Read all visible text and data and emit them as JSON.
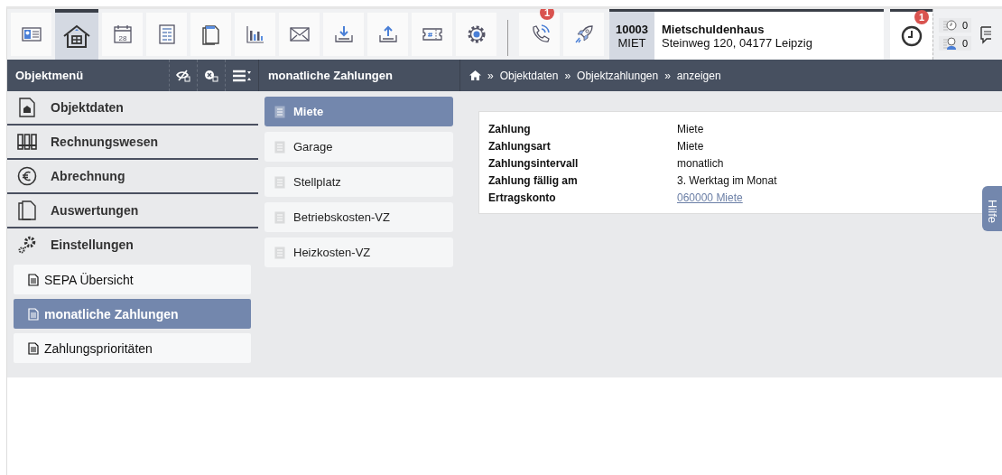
{
  "toolbar": {
    "buttons": [
      {
        "kind": "contact",
        "selected": false
      },
      {
        "kind": "home",
        "selected": true
      },
      {
        "kind": "calendar",
        "selected": false,
        "text": "28"
      },
      {
        "kind": "form",
        "selected": false
      },
      {
        "kind": "pages",
        "selected": false
      },
      {
        "kind": "chart",
        "selected": false
      },
      {
        "kind": "mail",
        "selected": false
      },
      {
        "kind": "download",
        "selected": false
      },
      {
        "kind": "upload",
        "selected": false
      },
      {
        "kind": "ticket",
        "selected": false
      },
      {
        "kind": "gear",
        "selected": false
      }
    ],
    "extra_buttons": [
      {
        "kind": "phone",
        "badge": "1"
      },
      {
        "kind": "rocket"
      }
    ],
    "object": {
      "number": "10003",
      "code": "MIET",
      "name": "Mietschuldenhaus",
      "address": "Steinweg 120, 04177 Leipzig"
    },
    "clock": {
      "badge": "1"
    },
    "counters": [
      {
        "kind": "clock",
        "count": "0"
      },
      {
        "kind": "person",
        "count": "0"
      }
    ]
  },
  "sidebar": {
    "title": "Objektmenü",
    "sections": [
      {
        "kind": "house",
        "label": "Objektdaten"
      },
      {
        "kind": "binders",
        "label": "Rechnungswesen"
      },
      {
        "kind": "euro",
        "label": "Abrechnung"
      },
      {
        "kind": "pages",
        "label": "Auswertungen"
      },
      {
        "kind": "gears",
        "label": "Einstellungen"
      }
    ],
    "items": [
      {
        "label": "SEPA Übersicht",
        "selected": false
      },
      {
        "label": "monatliche Zahlungen",
        "selected": true
      },
      {
        "label": "Zahlungsprioritäten",
        "selected": false
      }
    ]
  },
  "middle": {
    "title": "monatliche Zahlungen",
    "items": [
      {
        "label": "Miete",
        "selected": true
      },
      {
        "label": "Garage",
        "selected": false
      },
      {
        "label": "Stellplatz",
        "selected": false
      },
      {
        "label": "Betriebskosten-VZ",
        "selected": false
      },
      {
        "label": "Heizkosten-VZ",
        "selected": false
      }
    ]
  },
  "breadcrumb": [
    {
      "separator": "»",
      "label": "Objektdaten"
    },
    {
      "separator": "»",
      "label": "Objektzahlungen"
    },
    {
      "separator": "»",
      "label": "anzeigen"
    }
  ],
  "details": [
    {
      "label": "Zahlung",
      "value": "Miete",
      "kind": "text"
    },
    {
      "label": "Zahlungsart",
      "value": "Miete",
      "kind": "text"
    },
    {
      "label": "Zahlungsintervall",
      "value": "monatlich",
      "kind": "text"
    },
    {
      "label": "Zahlung fällig am",
      "value": "3. Werktag im Monat",
      "kind": "text"
    },
    {
      "label": "Ertragskonto",
      "value": "060000 Miete",
      "kind": "link"
    }
  ],
  "help_tab": "Hilfe"
}
